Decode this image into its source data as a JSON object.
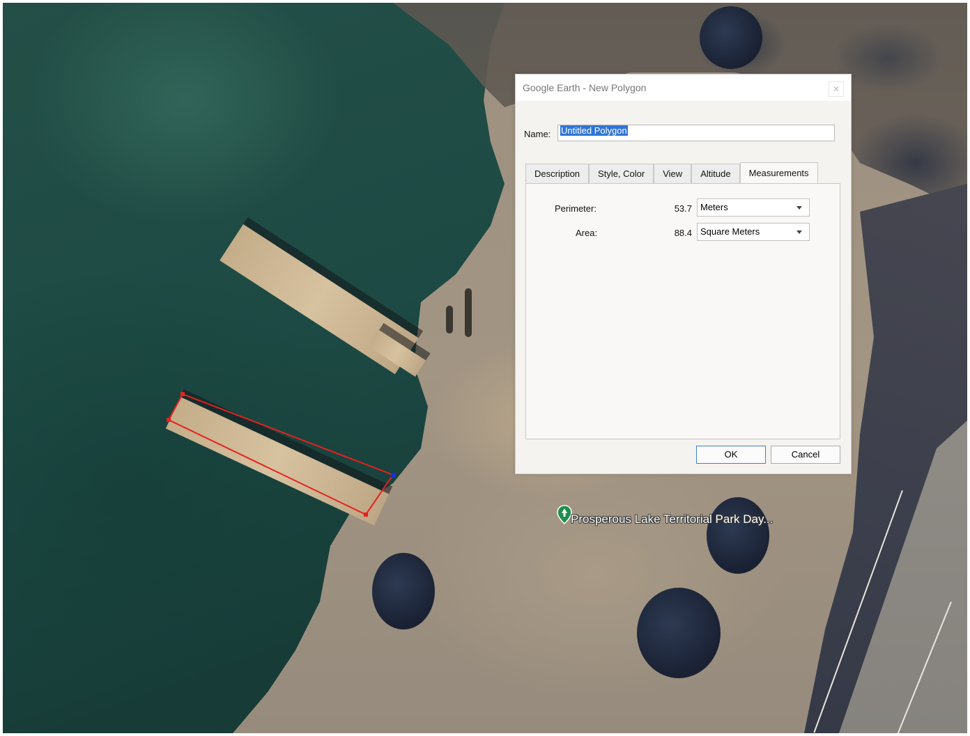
{
  "dialog": {
    "title": "Google Earth - New Polygon",
    "close_glyph": "✕",
    "name_label": "Name:",
    "name_value": "Untitled Polygon",
    "tabs": [
      {
        "label": "Description"
      },
      {
        "label": "Style, Color"
      },
      {
        "label": "View"
      },
      {
        "label": "Altitude"
      },
      {
        "label": "Measurements"
      }
    ],
    "active_tab": "Measurements",
    "perimeter": {
      "label": "Perimeter:",
      "value": "53.7",
      "unit": "Meters"
    },
    "area": {
      "label": "Area:",
      "value": "88.4",
      "unit": "Square Meters"
    },
    "ok_label": "OK",
    "cancel_label": "Cancel"
  },
  "map": {
    "place_label": "Prosperous Lake Territorial Park Day...",
    "pin_icon": "park-pin-icon",
    "polygon_color": "#e8201e",
    "vertex_active_color": "#1a2ee0"
  },
  "colors": {
    "accent": "#2f75d6"
  }
}
